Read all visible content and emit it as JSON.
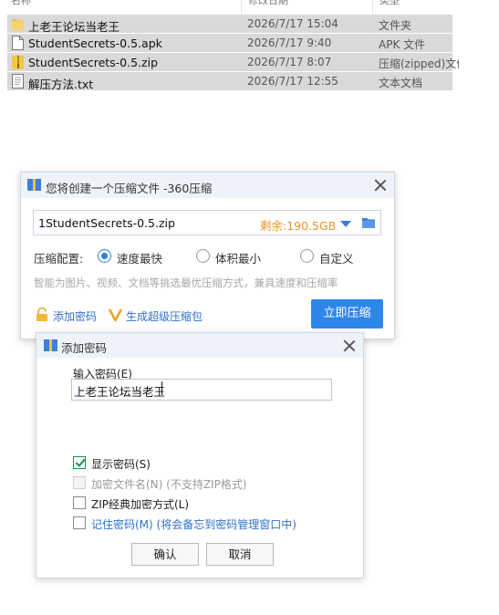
{
  "file_list": {
    "columns": [
      "名称",
      "修改日期",
      "类型"
    ],
    "rows": [
      {
        "name": "上老王论坛当老王",
        "date": "2026/7/17 15:04",
        "type": "文件夹",
        "icon": "folder-icon"
      },
      {
        "name": "StudentSecrets-0.5.apk",
        "date": "2026/7/17 9:40",
        "type": "APK 文件",
        "icon": "file-icon"
      },
      {
        "name": "StudentSecrets-0.5.zip",
        "date": "2026/7/17 8:07",
        "type": "压缩(zipped)文件",
        "icon": "zip-file-icon"
      },
      {
        "name": "解压方法.txt",
        "date": "2026/7/17 12:55",
        "type": "文本文档",
        "icon": "text-file-icon"
      }
    ]
  },
  "compress_dialog": {
    "title": "您将创建一个压缩文件 -360压缩",
    "filename": "1StudentSecrets-0.5.zip",
    "free_space": "剩余:190.5GB",
    "options_label": "压缩配置:",
    "options": [
      {
        "label": "速度最快",
        "selected": true
      },
      {
        "label": "体积最小",
        "selected": false
      },
      {
        "label": "自定义",
        "selected": false
      }
    ],
    "hint": "智能为图片、视频、文档等挑选最优压缩方式，兼具速度和压缩率",
    "add_password_label": "添加密码",
    "super_compress_label": "生成超级压缩包",
    "compress_button": "立即压缩",
    "accent_color": "#2f86ea"
  },
  "password_dialog": {
    "title": "添加密码",
    "input_label": "输入密码(E)",
    "password_value": "上老王论坛当老王",
    "show_password": {
      "label": "显示密码(S)",
      "checked": true
    },
    "encrypt_filenames": {
      "label": "加密文件名(N) (不支持ZIP格式)",
      "checked": false,
      "disabled": true
    },
    "zip_classic": {
      "label": "ZIP经典加密方式(L)",
      "checked": false
    },
    "remember_password": {
      "label": "记住密码(M) (将会备忘到密码管理窗口中)",
      "checked": false
    },
    "ok_button": "确认",
    "cancel_button": "取消"
  }
}
